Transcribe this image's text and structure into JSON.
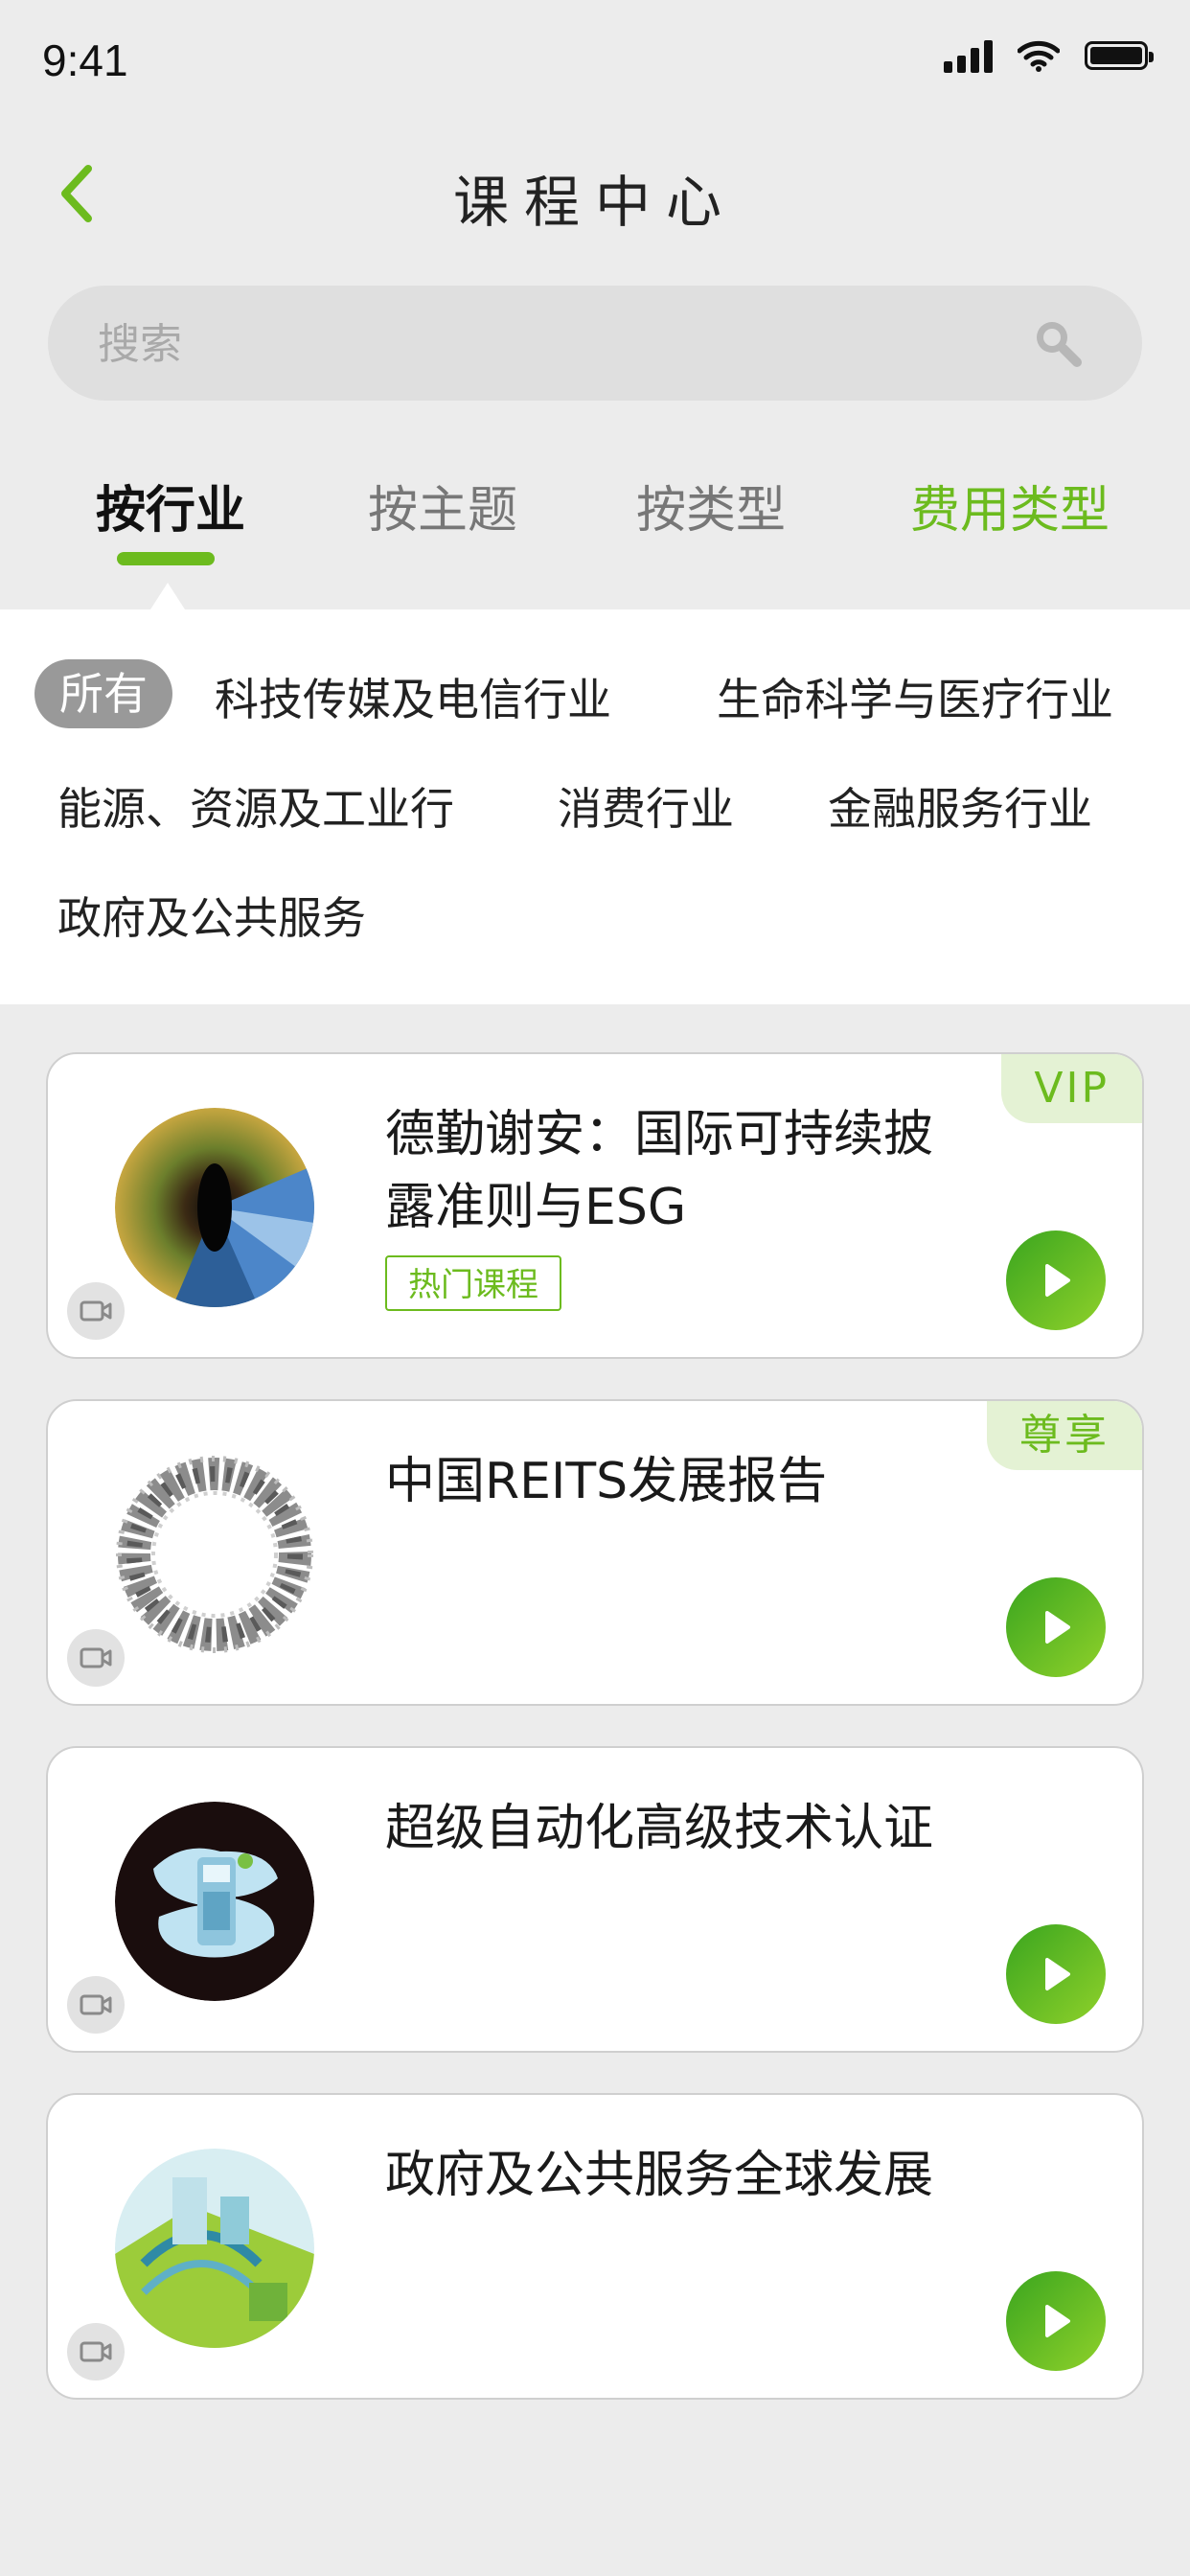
{
  "status_bar": {
    "time": "9:41"
  },
  "header": {
    "title": "课程中心"
  },
  "search": {
    "placeholder": "搜索"
  },
  "tabs": [
    {
      "label": "按行业",
      "state": "active"
    },
    {
      "label": "按主题"
    },
    {
      "label": "按类型"
    },
    {
      "label": "费用类型",
      "state": "accent"
    }
  ],
  "filters": [
    {
      "label": "所有",
      "selected": true
    },
    {
      "label": "科技传媒及电信行业"
    },
    {
      "label": "生命科学与医疗行业"
    },
    {
      "label": "能源、资源及工业行"
    },
    {
      "label": "消费行业"
    },
    {
      "label": "金融服务行业"
    },
    {
      "label": "政府及公共服务"
    }
  ],
  "courses": [
    {
      "title": "德勤谢安：国际可持续披露准则与ESG",
      "tag": "热门课程",
      "badge": "VIP",
      "media_icon": "video-camera-icon"
    },
    {
      "title": "中国REITS发展报告",
      "badge": "尊享",
      "media_icon": "video-camera-icon"
    },
    {
      "title": "超级自动化高级技术认证",
      "media_icon": "video-camera-icon"
    },
    {
      "title": "政府及公共服务全球发展",
      "media_icon": "video-camera-icon"
    }
  ],
  "colors": {
    "accent": "#6cbb1e",
    "background": "#ececec",
    "chip_selected": "#999999",
    "badge_bg": "#e4f2d4"
  }
}
